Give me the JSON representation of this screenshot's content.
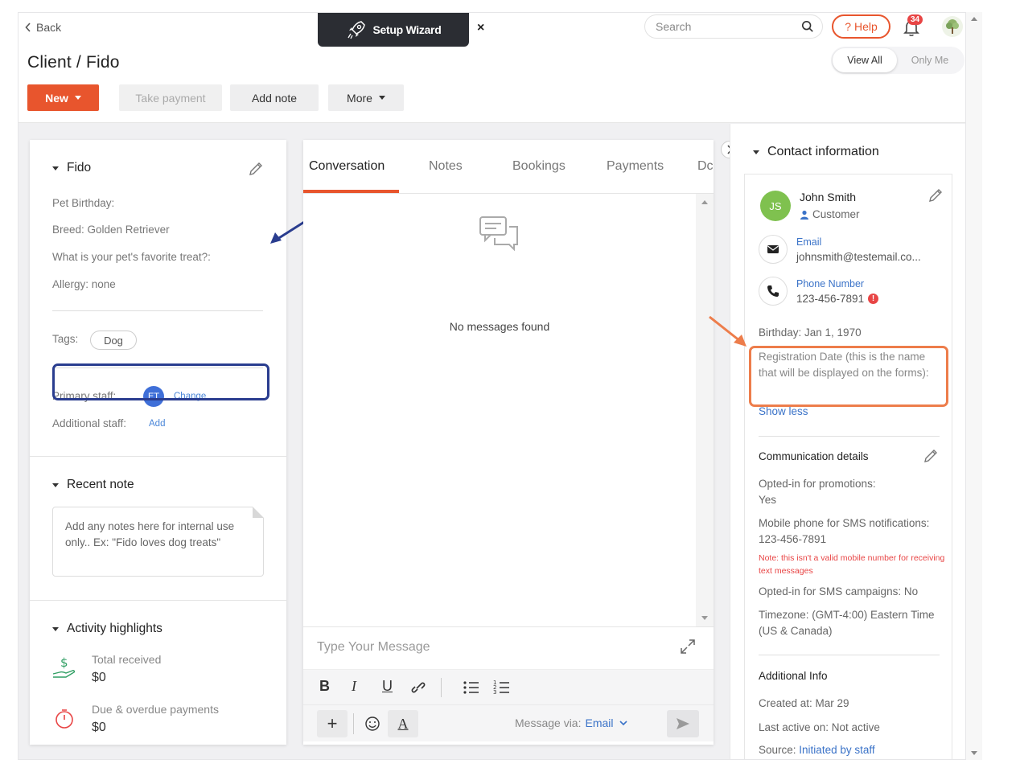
{
  "header": {
    "back_label": "Back",
    "page_title": "Client / Fido",
    "setup_wizard_label": "Setup Wizard",
    "setup_wizard_close": "×",
    "search_placeholder": "Search",
    "help_label": "Help",
    "help_prefix": "?",
    "notification_count": "34",
    "view_toggle": {
      "active": "View All",
      "inactive": "Only Me"
    }
  },
  "toolbar": {
    "new_label": "New",
    "take_payment_label": "Take payment",
    "add_note_label": "Add note",
    "more_label": "More"
  },
  "pet_panel": {
    "name": "Fido",
    "fields": {
      "birthday": "Pet Birthday:",
      "breed": "Breed: Golden Retriever",
      "favorite_treat": "What is your pet's favorite treat?:",
      "allergy": "Allergy: none"
    },
    "tags_label": "Tags:",
    "tag": "Dog",
    "primary_staff_label": "Primary staff:",
    "primary_staff_initials": "ET",
    "change_label": "Change",
    "additional_staff_label": "Additional staff:",
    "add_label": "Add",
    "recent_note_title": "Recent note",
    "note_placeholder": "Add any notes here for internal use only.. Ex: \"Fido loves dog treats\"",
    "activity_title": "Activity highlights",
    "total_received_label": "Total received",
    "total_received_value": "$0",
    "overdue_label": "Due & overdue payments",
    "overdue_value": "$0"
  },
  "conversation": {
    "tabs": [
      "Conversation",
      "Notes",
      "Bookings",
      "Payments",
      "Dc"
    ],
    "empty_text": "No messages found",
    "compose_placeholder": "Type Your Message",
    "format": {
      "bold": "B",
      "italic": "I",
      "underline": "U",
      "plus": "+",
      "text_color": "A"
    },
    "message_via_label": "Message via:",
    "message_via_value": "Email"
  },
  "contact": {
    "title": "Contact information",
    "initials": "JS",
    "name": "John Smith",
    "role": "Customer",
    "email_label": "Email",
    "email_value": "johnsmith@testemail.co...",
    "phone_label": "Phone Number",
    "phone_value": "123-456-7891",
    "birthday": "Birthday: Jan 1, 1970",
    "registration_date": "Registration Date (this is the name that will be displayed on the forms):",
    "show_less": "Show less",
    "comm_title": "Communication details",
    "promotions_label": "Opted-in for promotions:",
    "promotions_value": "Yes",
    "sms_phone": "Mobile phone for SMS notifications: 123-456-7891",
    "sms_note": "Note: this isn't a valid mobile number for receiving text messages",
    "sms_campaigns": "Opted-in for SMS campaigns: No",
    "timezone": "Timezone: (GMT-4:00) Eastern Time (US & Canada)",
    "additional_title": "Additional Info",
    "created_at": "Created at: Mar 29",
    "last_active": "Last active on: Not active",
    "source_label": "Source:",
    "source_value": "Initiated by staff"
  },
  "colors": {
    "accent": "#e8552d",
    "link": "#3b73c8",
    "annotation_blue": "#2a3d8f",
    "annotation_orange": "#ed7d4b",
    "contact_avatar": "#7fc14f",
    "staff_avatar": "#3f6fd8"
  }
}
